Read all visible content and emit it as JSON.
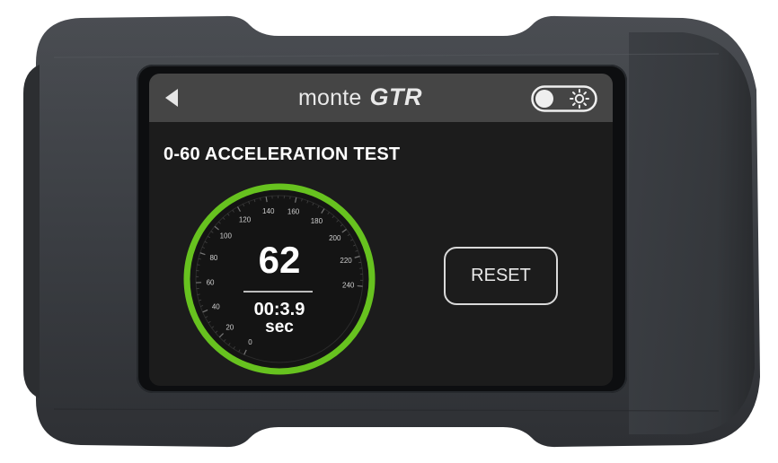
{
  "header": {
    "brand_light": "monte",
    "brand_bold": "GTR",
    "back_icon": "back-arrow-icon",
    "brightness_toggle_icon": "brightness-toggle-icon"
  },
  "screen": {
    "title": "0-60 ACCELERATION TEST",
    "gauge": {
      "ticks": [
        "0",
        "20",
        "40",
        "60",
        "80",
        "100",
        "120",
        "140",
        "160",
        "180",
        "200",
        "220",
        "240"
      ],
      "ring_color": "#67c21f",
      "speed": "62",
      "time": "00:3.9",
      "unit": "sec"
    },
    "reset_label": "RESET"
  },
  "colors": {
    "device_body": "#3a3d42",
    "screen_bg": "#1c1c1c",
    "header_bg": "#454545",
    "accent": "#67c21f"
  }
}
